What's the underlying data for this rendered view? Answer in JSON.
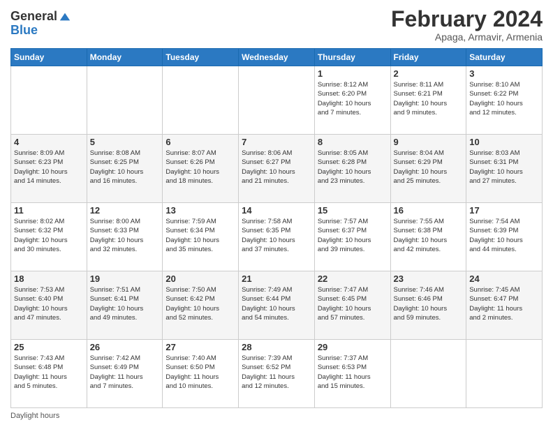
{
  "logo": {
    "line1": "General",
    "line2": "Blue"
  },
  "title": "February 2024",
  "subtitle": "Apaga, Armavir, Armenia",
  "days_of_week": [
    "Sunday",
    "Monday",
    "Tuesday",
    "Wednesday",
    "Thursday",
    "Friday",
    "Saturday"
  ],
  "footer": "Daylight hours",
  "weeks": [
    [
      {
        "num": "",
        "info": ""
      },
      {
        "num": "",
        "info": ""
      },
      {
        "num": "",
        "info": ""
      },
      {
        "num": "",
        "info": ""
      },
      {
        "num": "1",
        "info": "Sunrise: 8:12 AM\nSunset: 6:20 PM\nDaylight: 10 hours\nand 7 minutes."
      },
      {
        "num": "2",
        "info": "Sunrise: 8:11 AM\nSunset: 6:21 PM\nDaylight: 10 hours\nand 9 minutes."
      },
      {
        "num": "3",
        "info": "Sunrise: 8:10 AM\nSunset: 6:22 PM\nDaylight: 10 hours\nand 12 minutes."
      }
    ],
    [
      {
        "num": "4",
        "info": "Sunrise: 8:09 AM\nSunset: 6:23 PM\nDaylight: 10 hours\nand 14 minutes."
      },
      {
        "num": "5",
        "info": "Sunrise: 8:08 AM\nSunset: 6:25 PM\nDaylight: 10 hours\nand 16 minutes."
      },
      {
        "num": "6",
        "info": "Sunrise: 8:07 AM\nSunset: 6:26 PM\nDaylight: 10 hours\nand 18 minutes."
      },
      {
        "num": "7",
        "info": "Sunrise: 8:06 AM\nSunset: 6:27 PM\nDaylight: 10 hours\nand 21 minutes."
      },
      {
        "num": "8",
        "info": "Sunrise: 8:05 AM\nSunset: 6:28 PM\nDaylight: 10 hours\nand 23 minutes."
      },
      {
        "num": "9",
        "info": "Sunrise: 8:04 AM\nSunset: 6:29 PM\nDaylight: 10 hours\nand 25 minutes."
      },
      {
        "num": "10",
        "info": "Sunrise: 8:03 AM\nSunset: 6:31 PM\nDaylight: 10 hours\nand 27 minutes."
      }
    ],
    [
      {
        "num": "11",
        "info": "Sunrise: 8:02 AM\nSunset: 6:32 PM\nDaylight: 10 hours\nand 30 minutes."
      },
      {
        "num": "12",
        "info": "Sunrise: 8:00 AM\nSunset: 6:33 PM\nDaylight: 10 hours\nand 32 minutes."
      },
      {
        "num": "13",
        "info": "Sunrise: 7:59 AM\nSunset: 6:34 PM\nDaylight: 10 hours\nand 35 minutes."
      },
      {
        "num": "14",
        "info": "Sunrise: 7:58 AM\nSunset: 6:35 PM\nDaylight: 10 hours\nand 37 minutes."
      },
      {
        "num": "15",
        "info": "Sunrise: 7:57 AM\nSunset: 6:37 PM\nDaylight: 10 hours\nand 39 minutes."
      },
      {
        "num": "16",
        "info": "Sunrise: 7:55 AM\nSunset: 6:38 PM\nDaylight: 10 hours\nand 42 minutes."
      },
      {
        "num": "17",
        "info": "Sunrise: 7:54 AM\nSunset: 6:39 PM\nDaylight: 10 hours\nand 44 minutes."
      }
    ],
    [
      {
        "num": "18",
        "info": "Sunrise: 7:53 AM\nSunset: 6:40 PM\nDaylight: 10 hours\nand 47 minutes."
      },
      {
        "num": "19",
        "info": "Sunrise: 7:51 AM\nSunset: 6:41 PM\nDaylight: 10 hours\nand 49 minutes."
      },
      {
        "num": "20",
        "info": "Sunrise: 7:50 AM\nSunset: 6:42 PM\nDaylight: 10 hours\nand 52 minutes."
      },
      {
        "num": "21",
        "info": "Sunrise: 7:49 AM\nSunset: 6:44 PM\nDaylight: 10 hours\nand 54 minutes."
      },
      {
        "num": "22",
        "info": "Sunrise: 7:47 AM\nSunset: 6:45 PM\nDaylight: 10 hours\nand 57 minutes."
      },
      {
        "num": "23",
        "info": "Sunrise: 7:46 AM\nSunset: 6:46 PM\nDaylight: 10 hours\nand 59 minutes."
      },
      {
        "num": "24",
        "info": "Sunrise: 7:45 AM\nSunset: 6:47 PM\nDaylight: 11 hours\nand 2 minutes."
      }
    ],
    [
      {
        "num": "25",
        "info": "Sunrise: 7:43 AM\nSunset: 6:48 PM\nDaylight: 11 hours\nand 5 minutes."
      },
      {
        "num": "26",
        "info": "Sunrise: 7:42 AM\nSunset: 6:49 PM\nDaylight: 11 hours\nand 7 minutes."
      },
      {
        "num": "27",
        "info": "Sunrise: 7:40 AM\nSunset: 6:50 PM\nDaylight: 11 hours\nand 10 minutes."
      },
      {
        "num": "28",
        "info": "Sunrise: 7:39 AM\nSunset: 6:52 PM\nDaylight: 11 hours\nand 12 minutes."
      },
      {
        "num": "29",
        "info": "Sunrise: 7:37 AM\nSunset: 6:53 PM\nDaylight: 11 hours\nand 15 minutes."
      },
      {
        "num": "",
        "info": ""
      },
      {
        "num": "",
        "info": ""
      }
    ]
  ]
}
